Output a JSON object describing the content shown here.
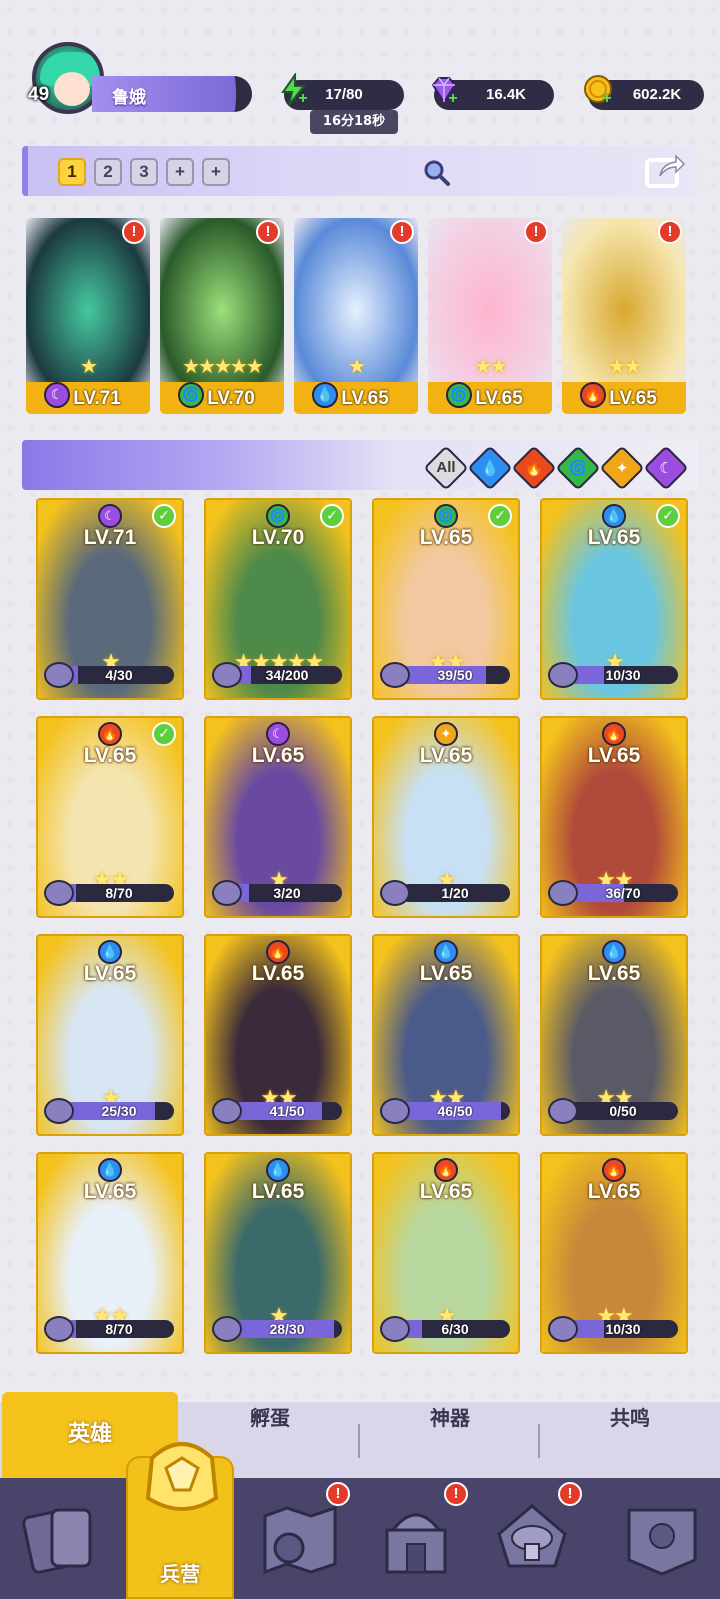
{
  "player": {
    "level": "49",
    "name": "鲁娥"
  },
  "resources": {
    "energy": "17/80",
    "energy_timer": "16分18秒",
    "gems": "16.4K",
    "gold": "602.2K"
  },
  "team_slots": [
    "1",
    "2",
    "3",
    "+",
    "+"
  ],
  "top_team": [
    {
      "level": "LV.71",
      "element": "dark",
      "stars": "★",
      "alert": "!"
    },
    {
      "level": "LV.70",
      "element": "wind",
      "stars": "★★★★★",
      "alert": "!"
    },
    {
      "level": "LV.65",
      "element": "water",
      "stars": "★",
      "alert": "!"
    },
    {
      "level": "LV.65",
      "element": "wind",
      "stars": "★★",
      "alert": "!"
    },
    {
      "level": "LV.65",
      "element": "fire",
      "stars": "★★",
      "alert": "!"
    }
  ],
  "filters": {
    "all_label": "All",
    "elements": [
      "water",
      "fire",
      "wind",
      "light",
      "dark"
    ]
  },
  "heroes": [
    {
      "level": "LV.71",
      "element": "dark",
      "progress": "4/30",
      "frac": 0.13,
      "stars": "★",
      "checked": true
    },
    {
      "level": "LV.70",
      "element": "wind",
      "progress": "34/200",
      "frac": 0.17,
      "stars": "★★★★★",
      "checked": true
    },
    {
      "level": "LV.65",
      "element": "wind",
      "progress": "39/50",
      "frac": 0.78,
      "stars": "★★",
      "checked": true
    },
    {
      "level": "LV.65",
      "element": "water",
      "progress": "10/30",
      "frac": 0.33,
      "stars": "★",
      "checked": true
    },
    {
      "level": "LV.65",
      "element": "fire",
      "progress": "8/70",
      "frac": 0.11,
      "stars": "★★",
      "checked": true
    },
    {
      "level": "LV.65",
      "element": "dark",
      "progress": "3/20",
      "frac": 0.15,
      "stars": "★",
      "checked": false
    },
    {
      "level": "LV.65",
      "element": "light",
      "progress": "1/20",
      "frac": 0.05,
      "stars": "★",
      "checked": false
    },
    {
      "level": "LV.65",
      "element": "fire",
      "progress": "36/70",
      "frac": 0.51,
      "stars": "★★",
      "checked": false
    },
    {
      "level": "LV.65",
      "element": "water",
      "progress": "25/30",
      "frac": 0.83,
      "stars": "★",
      "checked": false
    },
    {
      "level": "LV.65",
      "element": "fire",
      "progress": "41/50",
      "frac": 0.82,
      "stars": "★★",
      "checked": false
    },
    {
      "level": "LV.65",
      "element": "water",
      "progress": "46/50",
      "frac": 0.92,
      "stars": "★★",
      "checked": false
    },
    {
      "level": "LV.65",
      "element": "water",
      "progress": "0/50",
      "frac": 0.0,
      "stars": "★★",
      "checked": false
    },
    {
      "level": "LV.65",
      "element": "water",
      "progress": "8/70",
      "frac": 0.11,
      "stars": "★★",
      "checked": false
    },
    {
      "level": "LV.65",
      "element": "water",
      "progress": "28/30",
      "frac": 0.93,
      "stars": "★",
      "checked": false
    },
    {
      "level": "LV.65",
      "element": "fire",
      "progress": "6/30",
      "frac": 0.2,
      "stars": "★",
      "checked": false
    },
    {
      "level": "LV.65",
      "element": "fire",
      "progress": "10/30",
      "frac": 0.33,
      "stars": "★★",
      "checked": false
    }
  ],
  "tabs": [
    "英雄",
    "孵蛋",
    "神器",
    "共鸣"
  ],
  "nav": {
    "active_label": "兵营",
    "alert": "!"
  },
  "colors": {
    "water": "#2d8ef0",
    "fire": "#e84a1d",
    "wind": "#35b84a",
    "light": "#f0a619",
    "dark": "#9a4de0"
  },
  "element_glyphs": {
    "water": "💧",
    "fire": "🔥",
    "wind": "🌀",
    "light": "✦",
    "dark": "☾"
  }
}
